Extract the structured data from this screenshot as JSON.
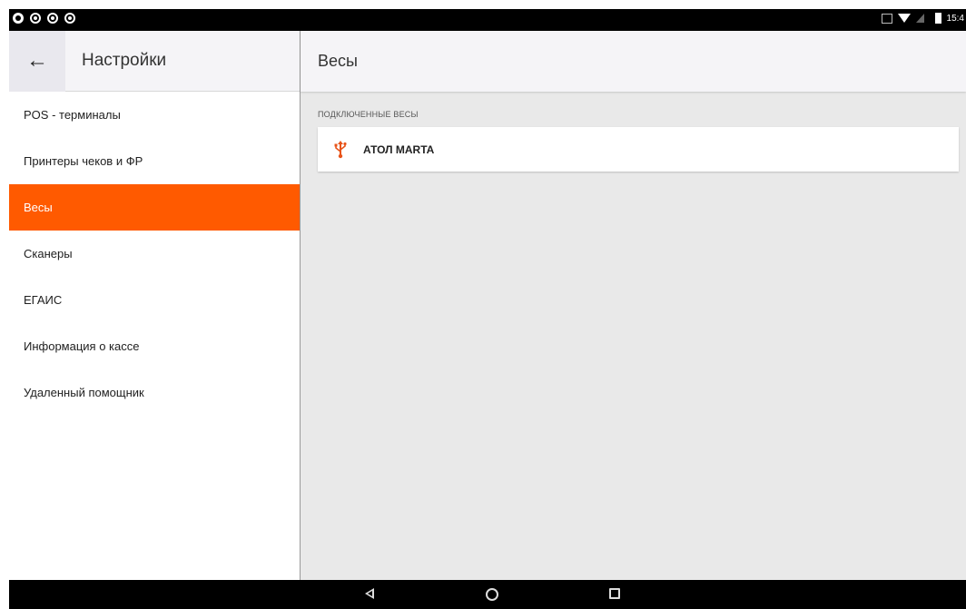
{
  "status_bar": {
    "time": "15:4",
    "left_icons": [
      "gear-icon",
      "record-icon",
      "record-icon",
      "record-icon"
    ],
    "right_icons": [
      "cast-icon",
      "wifi-icon",
      "signal-icon",
      "battery-icon"
    ]
  },
  "settings": {
    "title": "Настройки",
    "back_icon": "back-arrow-icon",
    "menu": [
      {
        "label": "POS - терминалы"
      },
      {
        "label": "Принтеры чеков и ФР"
      },
      {
        "label": "Весы",
        "active": true
      },
      {
        "label": "Сканеры"
      },
      {
        "label": "ЕГАИС"
      },
      {
        "label": "Информация о кассе"
      },
      {
        "label": "Удаленный помощник"
      }
    ]
  },
  "detail": {
    "title": "Весы",
    "section_label": "ПОДКЛЮЧЕННЫЕ ВЕСЫ",
    "devices": [
      {
        "name": "АТОЛ MARTA",
        "icon": "usb-icon"
      }
    ]
  },
  "navigation_bar": {
    "buttons": [
      "nav-back-icon",
      "nav-home-icon",
      "nav-recents-icon"
    ]
  },
  "colors": {
    "accent": "#ff5a00",
    "usb_icon": "#e8541a",
    "content_bg": "#e9e9e9",
    "header_bg": "#f5f4f7"
  }
}
